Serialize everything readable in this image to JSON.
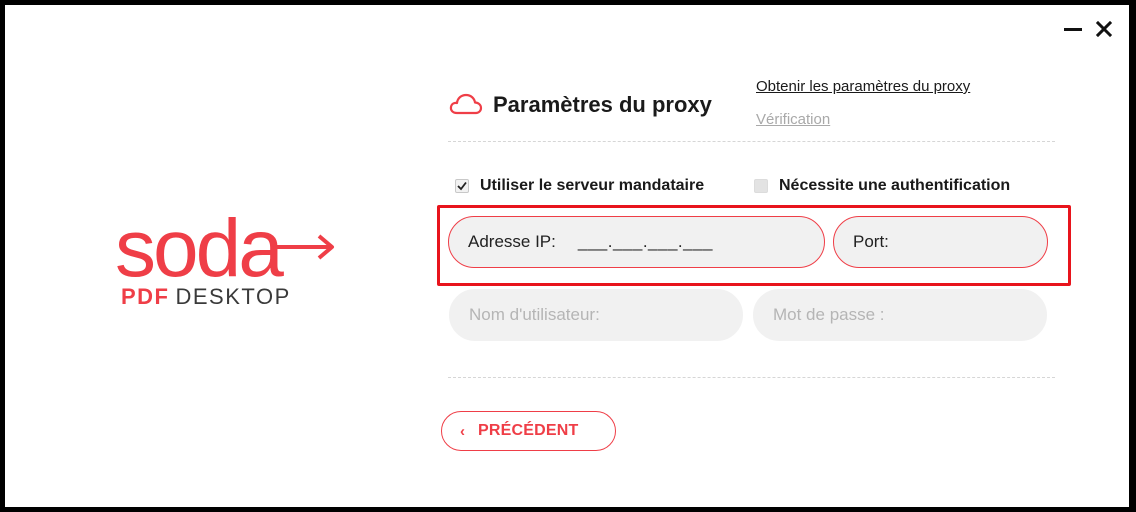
{
  "window": {
    "minimize_icon": "minimize-icon",
    "close_icon": "close-icon"
  },
  "logo": {
    "word": "soda",
    "sub_bold": "PDF",
    "sub_light": "DESKTOP",
    "brand_color": "#ef3e47"
  },
  "header": {
    "icon": "cloud-icon",
    "title": "Paramètres du proxy",
    "obtain_link": "Obtenir les paramètres du proxy",
    "verify_link": "Vérification"
  },
  "options": {
    "use_proxy": {
      "label": "Utiliser le serveur mandataire",
      "checked": true
    },
    "require_auth": {
      "label": "Nécessite une authentification",
      "checked": false
    }
  },
  "fields": {
    "ip": {
      "label": "Adresse IP:",
      "value": "___.___.___.___"
    },
    "port": {
      "label": "Port:",
      "value": ""
    },
    "username": {
      "placeholder": "Nom d'utilisateur:"
    },
    "password": {
      "placeholder": "Mot de passe :"
    }
  },
  "footer": {
    "back_label": "PRÉCÉDENT",
    "back_icon": "chevron-left-icon"
  },
  "colors": {
    "accent": "#ef3e47",
    "highlight": "#e8141c",
    "field_bg": "#f1f1f1"
  }
}
